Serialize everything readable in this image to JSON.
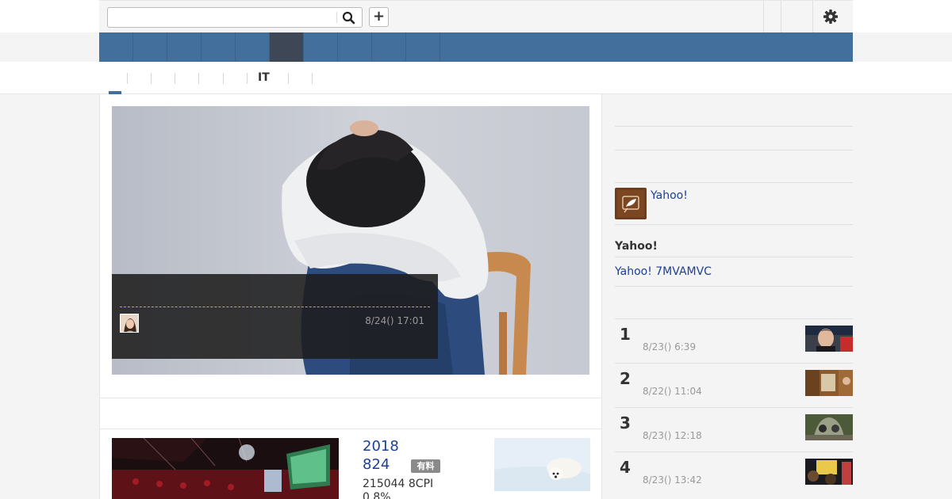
{
  "search": {
    "placeholder": "",
    "value": ""
  },
  "topbar": {
    "plus_label": "+"
  },
  "nav": {
    "tabs": [
      "",
      "",
      "",
      "",
      "",
      "",
      "",
      "",
      "",
      ""
    ],
    "active_index": 5
  },
  "subnav": {
    "tabs": [
      "",
      "",
      "",
      "",
      "",
      "IT",
      "",
      ""
    ],
    "active_index": 0
  },
  "hero": {
    "time": "8/24() 17:01"
  },
  "article": {
    "title_line1": "2018",
    "title_line2": "824",
    "badge": "有料",
    "desc_line1": "215044 8CPI",
    "desc_line2": "0.8%"
  },
  "sidebar": {
    "link1": "Yahoo!",
    "heading": "Yahoo!",
    "link2": "Yahoo! 7MVAMVC",
    "ranking": [
      {
        "rank": "1",
        "time": "8/23() 6:39"
      },
      {
        "rank": "2",
        "time": "8/22() 11:04"
      },
      {
        "rank": "3",
        "time": "8/23() 12:18"
      },
      {
        "rank": "4",
        "time": "8/23() 13:42"
      }
    ]
  },
  "colors": {
    "nav_blue": "#436f9c",
    "nav_active": "#3d4756",
    "link_blue": "#1d3f98",
    "badge_gray": "#8a8a8a"
  },
  "icons": [
    "search-icon",
    "plus-icon",
    "gear-icon",
    "feather-icon"
  ]
}
